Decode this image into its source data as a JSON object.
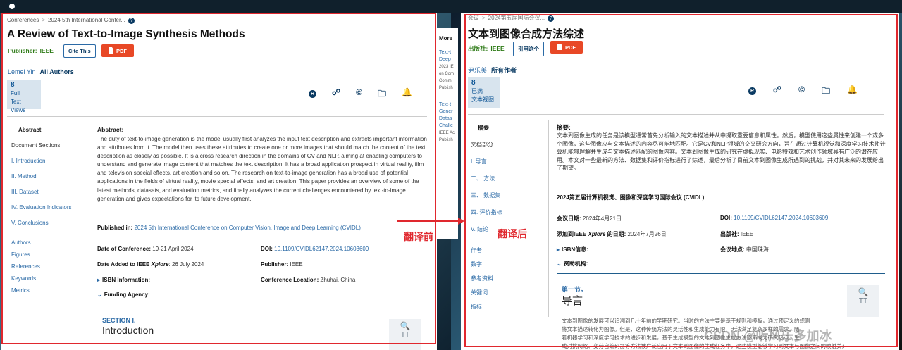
{
  "colors": {
    "accent_red": "#e0282e",
    "link_blue": "#2b6aa6",
    "pdf_orange": "#e84826",
    "publisher_green": "#2d7a16"
  },
  "annotations": {
    "before": "翻译前",
    "after": "翻译后"
  },
  "left": {
    "breadcrumb": [
      "Conferences",
      "2024 5th International Confer..."
    ],
    "title": "A Review of Text-to-Image Synthesis Methods",
    "publisher_label": "Publisher:",
    "publisher_value": "IEEE",
    "cite_label": "Cite This",
    "pdf_label": "PDF",
    "author": "Lemei Yin",
    "all_authors": "All Authors",
    "views": {
      "count": "8",
      "l1": "Full",
      "l2": "Text Views"
    },
    "nav": [
      "Abstract",
      "Document Sections",
      "I. Introduction",
      "II. Method",
      "III. Dataset",
      "IV. Evaluation Indicators",
      "V. Conclusions",
      "Authors",
      "Figures",
      "References",
      "Keywords",
      "Metrics"
    ],
    "abstract_label": "Abstract:",
    "abstract_text": "The duty of text-to-image generation is the model usually first analyzes the input text description and extracts important information and attributes from it. The model then uses these attributes to create one or more images that should match the content of the text description as closely as possible. It is a cross research direction in the domains of CV and NLP, aiming at enabling computers to understand and generate image content that matches the text description. It has a broad application prospect in virtual reality, film and television special effects, art creation and so on. The research on text-to-image generation has a broad use of potential applications in the fields of virtual reality, movie special effects, and art creation. This paper provides an overview of some of the latest methods, datasets, and evaluation metrics, and finally analyzes the current challenges encountered by text-to-image generation and gives expectations for its future development.",
    "published_in_label": "Published in:",
    "published_in_value": "2024 5th International Conference on Computer Vision, Image and Deep Learning (CVIDL)",
    "date_conf_label": "Date of Conference:",
    "date_conf_value": "19-21 April 2024",
    "doi_label": "DOI:",
    "doi_value": "10.1109/CVIDL62147.2024.10603609",
    "date_added_label": "Date Added to IEEE",
    "date_added_italic": "Xplore",
    "date_added_value": ": 26 July 2024",
    "publisher2_label": "Publisher:",
    "publisher2_value": "IEEE",
    "isbn_label": "ISBN Information:",
    "location_label": "Conference Location:",
    "location_value": "Zhuhai, China",
    "funding_label": "Funding Agency:",
    "section_kicker": "SECTION I.",
    "section_title": "Introduction",
    "side_more": "More",
    "side_items": [
      "Text-t",
      "Deep",
      "2023 IE",
      "on Com",
      "Comm",
      "Publish",
      "Text-t",
      "Gener",
      "Datas",
      "Challe",
      "IEEE Ac",
      "Publish"
    ]
  },
  "right": {
    "breadcrumb": [
      "会议",
      "2024第五届国际会议..."
    ],
    "title": "文本到图像合成方法综述",
    "publisher_label": "出版社:",
    "publisher_value": "IEEE",
    "cite_label": "引用这个",
    "pdf_label": "PDF",
    "author": "尹乐美",
    "all_authors": "所有作者",
    "views": {
      "count": "8",
      "l1": "已满",
      "l2": "文本视图"
    },
    "nav": [
      "摘要",
      "文档部分",
      "I. 导言",
      "二、 方法",
      "三、 数据集",
      "四. 评价指标",
      "V. 结论",
      "作者",
      "数字",
      "参考资料",
      "关键词",
      "指标"
    ],
    "abstract_label": "摘要:",
    "abstract_text": "文本到图像生成的任务是该模型通常首先分析输入的文本描述并从中提取重要信息和属性。然后，模型使用这些属性来创建一个或多个图像，这些图像应与文本描述的内容尽可能地匹配。它是CV和NLP领域的交叉研究方向，旨在通过计算机视觉和深度学习技术使计算机能够理解并生成与文本描述匹配的图像内容。文本到图像生成的研究在虚拟现实、电影特效和艺术创作领域具有广泛的潜在应用。本文对一些最新的方法、数据集和评价指标进行了综述，最后分析了目前文本到图像生成所遇到的挑战，并对其未来的发展给出了期望。",
    "conf_name": "2024第五届计算机视觉、图像和深度学习国际会议 (CVIDL)",
    "date_conf_label": "会议日期:",
    "date_conf_value": "2024年4月21日",
    "doi_label": "DOI:",
    "doi_value": "10.1109/CVIDL62147.2024.10603609",
    "date_added_label": "添加到IEEE",
    "date_added_italic": "Xplore",
    "date_added_label2": "的日期:",
    "date_added_value": "2024年7月26日",
    "publisher2_label": "出版社:",
    "publisher2_value": "IEEE",
    "isbn_label": "ISBN信息:",
    "location_label": "会议地点:",
    "location_value": "中国珠海",
    "funding_label": "资助机构:",
    "section_kicker": "第一节。",
    "section_title": "导言",
    "body_lines": [
      "文本到图像的发展可以追溯到几十年前的早期研究。当时的方法主要是基于规则和模板，通过预定义的规则",
      "将文本描述转化为图像。但是，这种传统方法的灵活性和生成能力有限，无法满足复杂多样的需求。随",
      "着机器学习和深度学习技术的进步和发展，基于生成模型的文本到图像生成方法逐渐成为研究热点。生",
      "成对抗网络、变分自编码器等方法被广泛应用于文本到图像的生成任务中，这些模型能够学习到文本与图像之间的映射关系。"
    ],
    "watermark": "CSDN @听风乐多加冰"
  }
}
